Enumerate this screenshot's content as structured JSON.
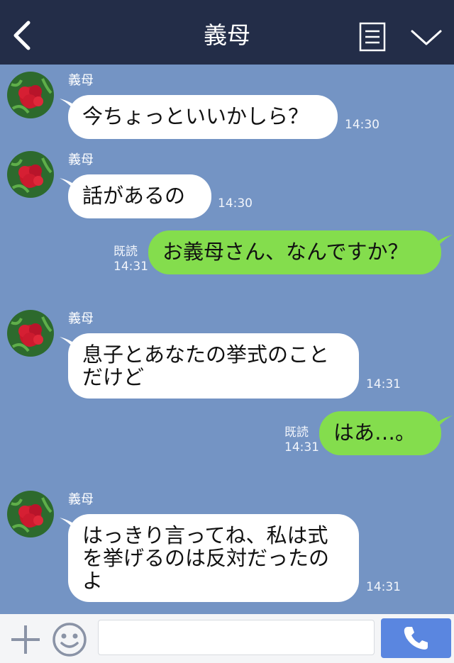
{
  "header": {
    "title": "義母"
  },
  "messages": [
    {
      "sender": "義母",
      "text": "今ちょっといいかしら？",
      "time": "14:30"
    },
    {
      "sender": "義母",
      "text": "話があるの",
      "time": "14:30"
    },
    {
      "read": "既読",
      "text": "お義母さん、なんですか？",
      "time": "14:31"
    },
    {
      "sender": "義母",
      "text": "息子とあなたの挙式のこと\nだけど",
      "time": "14:31"
    },
    {
      "read": "既読",
      "text": "はあ…。",
      "time": "14:31"
    },
    {
      "sender": "義母",
      "text": "はっきり言ってね、私は式\nを挙げるのは反対だったの\nよ",
      "time": "14:31"
    }
  ],
  "input": {
    "value": ""
  },
  "colors": {
    "header_bg": "#232d48",
    "chat_bg": "#7494c4",
    "outgoing": "#84dd4d",
    "incoming": "#ffffff",
    "call_button": "#5a86e0"
  },
  "icons": [
    "back-arrow-icon",
    "notes-icon",
    "chevron-down-icon",
    "plus-icon",
    "emoji-icon",
    "phone-icon"
  ]
}
